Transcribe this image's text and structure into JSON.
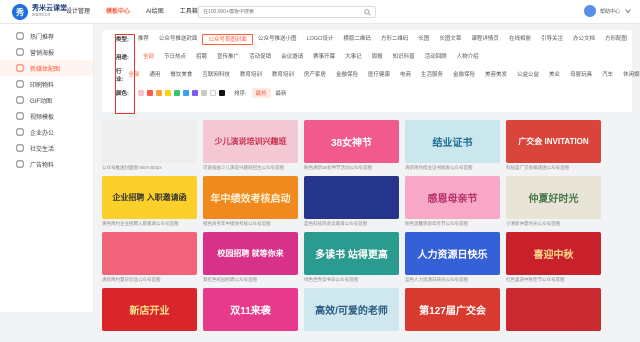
{
  "app": {
    "logo_short": "秀",
    "logo_name": "秀米云课堂",
    "logo_sub": "xiumi.cn"
  },
  "nav": [
    "设计管理",
    "模板中心",
    "AI绘图",
    "工具箱"
  ],
  "search": {
    "placeholder": "在100,000+模板中搜索"
  },
  "user": {
    "label": "帮助中心"
  },
  "sidebar": [
    {
      "label": "热门推荐",
      "icon": "fire-icon"
    },
    {
      "label": "营销海报",
      "icon": "poster-icon"
    },
    {
      "label": "新媒体配图",
      "icon": "image-icon",
      "active": true
    },
    {
      "label": "印刷物料",
      "icon": "print-icon"
    },
    {
      "label": "GIF动图",
      "icon": "gif-icon"
    },
    {
      "label": "视频模板",
      "icon": "video-icon"
    },
    {
      "label": "企业办公",
      "icon": "office-icon"
    },
    {
      "label": "社交生活",
      "icon": "social-icon"
    },
    {
      "label": "广告物料",
      "icon": "ad-icon"
    }
  ],
  "filters": {
    "type": {
      "label": "类型:",
      "options": [
        "推荐",
        "公众号推送封面",
        "公众号首图封面",
        "公众号推送小图",
        "LOGO设计",
        "横版二维码",
        "方形二维码",
        "长图",
        "长图文章",
        "课程详情页",
        "在线相册",
        "引导关注",
        "办公文档",
        "方形配图"
      ],
      "boxed": 2
    },
    "use": {
      "label": "用途:",
      "options": [
        "全部",
        "节日热点",
        "招聘",
        "宣传推广",
        "活动促销",
        "会议邀请",
        "赛事开幕",
        "大事记",
        "周报",
        "知识科普",
        "活动回顾",
        "人物介绍"
      ],
      "active": 0
    },
    "industry": {
      "label": "行业:",
      "options": [
        "全部",
        "通用",
        "餐饮美食",
        "互联网科技",
        "教育培训",
        "教育培训",
        "房产家居",
        "金融保险",
        "医疗健康",
        "电商",
        "生活服务",
        "金融保险",
        "美容美发",
        "公益公益",
        "美业",
        "母婴玩具",
        "汽车",
        "休闲娱乐"
      ],
      "active": 0
    },
    "color": {
      "label": "颜色:",
      "swatches": [
        "#f7c5d0",
        "#ff5b4a",
        "#ff9f3a",
        "#ffd400",
        "#39c36e",
        "#3aa0f0",
        "#7c5cf0",
        "#c8c8c8",
        "#ffffff",
        "#111111"
      ],
      "sort_label": "排序:",
      "sort_options": [
        "最热",
        "最新"
      ]
    }
  },
  "cards": [
    {
      "title": "",
      "bg": "#eeeeee",
      "fg": "#999",
      "caption": "公众号推送封面图 900×383px"
    },
    {
      "title": "少儿演说培训兴趣班",
      "bg": "#f3c7d3",
      "fg": "#c8324f",
      "caption": "可爱插画少儿演说兴趣班招生公众号首图"
    },
    {
      "title": "38女神节",
      "bg": "#f05a8c",
      "fg": "#ffffff",
      "caption": "粉色清新38女神节活动公众号首图"
    },
    {
      "title": "结业证书",
      "bg": "#cbe7ee",
      "fg": "#1a6c8e",
      "caption": "清新简约结业证书颁发公众号首图"
    },
    {
      "title": "广交会 INVITATION",
      "bg": "#d9453b",
      "fg": "#ffffff",
      "caption": "科技蓝广交会邀请函公众号首图"
    },
    {
      "title": "企业招聘 入职邀请函",
      "bg": "#fbd02a",
      "fg": "#333333",
      "caption": "黄色简约企业招聘入职邀请公众号首图"
    },
    {
      "title": "年中绩效考核启动",
      "bg": "#f0891e",
      "fg": "#fff3d6",
      "caption": "橙色商务年中绩效考核公众号首图"
    },
    {
      "title": "",
      "bg": "#26358c",
      "fg": "#ffffff",
      "caption": "蓝色科技风会议邀请公众号首图"
    },
    {
      "title": "感恩母亲节",
      "bg": "#f7a8c4",
      "fg": "#b8326c",
      "caption": "粉色温馨感恩母亲节公众号首图"
    },
    {
      "title": "仲夏好时光",
      "bg": "#e8e4d8",
      "fg": "#4a7a4a",
      "caption": "小清新仲夏时光公众号首图"
    },
    {
      "title": "",
      "bg": "#f0637a",
      "fg": "#ffffff",
      "caption": "清新简约夏日饮品公众号首图"
    },
    {
      "title": "校园招聘 就等你来",
      "bg": "#d8318a",
      "fg": "#ffffff",
      "caption": "紫红色校园招聘公众号首图"
    },
    {
      "title": "多读书 站得更高",
      "bg": "#2b9a8f",
      "fg": "#ffffff",
      "caption": "绿色世界读书日公众号首图"
    },
    {
      "title": "人力资源日快乐",
      "bg": "#3560d8",
      "fg": "#ffffff",
      "caption": "蓝色人力资源日快乐公众号首图"
    },
    {
      "title": "喜迎中秋",
      "bg": "#c8212c",
      "fg": "#ffd98a",
      "caption": "红色喜迎中秋佳节公众号首图"
    },
    {
      "title": "新店开业",
      "bg": "#d8262a",
      "fg": "#ffe48a",
      "caption": ""
    },
    {
      "title": "双11来袭",
      "bg": "#e83a8a",
      "fg": "#ffffff",
      "caption": ""
    },
    {
      "title": "高效/可爱的老师",
      "bg": "#cfe8ef",
      "fg": "#2a5a80",
      "caption": ""
    },
    {
      "title": "第127届广交会",
      "bg": "#d93a30",
      "fg": "#ffffff",
      "caption": ""
    },
    {
      "title": "",
      "bg": "#c82a30",
      "fg": "#ffffff",
      "caption": ""
    }
  ]
}
